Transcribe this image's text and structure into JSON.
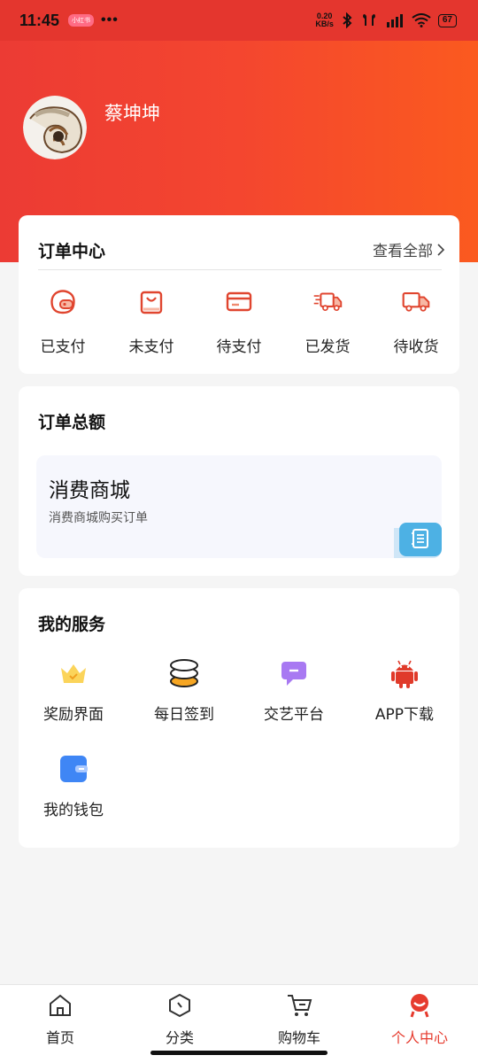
{
  "status_bar": {
    "time": "11:45",
    "badge": "小红书",
    "dots": "•••",
    "speed_value": "0.20",
    "speed_unit": "KB/s",
    "battery": "67"
  },
  "profile": {
    "username": "蔡坤坤"
  },
  "order_center": {
    "title": "订单中心",
    "view_all": "查看全部",
    "items": [
      {
        "label": "已支付",
        "icon": "wallet-icon"
      },
      {
        "label": "未支付",
        "icon": "shopping-bag-icon"
      },
      {
        "label": "待支付",
        "icon": "card-icon"
      },
      {
        "label": "已发货",
        "icon": "delivery-truck-fast-icon"
      },
      {
        "label": "待收货",
        "icon": "delivery-truck-icon"
      }
    ]
  },
  "order_total": {
    "title": "订单总额",
    "mall_title": "消费商城",
    "mall_subtitle": "消费商城购买订单"
  },
  "services": {
    "title": "我的服务",
    "items": [
      {
        "label": "奖励界面",
        "icon": "crown-icon"
      },
      {
        "label": "每日签到",
        "icon": "coins-stack-icon"
      },
      {
        "label": "交艺平台",
        "icon": "chat-bubble-icon"
      },
      {
        "label": "APP下载",
        "icon": "android-icon"
      },
      {
        "label": "我的钱包",
        "icon": "wallet-blue-icon"
      }
    ]
  },
  "tabbar": {
    "items": [
      {
        "label": "首页",
        "icon": "home-icon"
      },
      {
        "label": "分类",
        "icon": "category-icon"
      },
      {
        "label": "购物车",
        "icon": "cart-icon"
      },
      {
        "label": "个人中心",
        "icon": "profile-icon",
        "active": true
      }
    ]
  },
  "colors": {
    "accent": "#e63b2e",
    "hero_start": "#ec3b34",
    "hero_end": "#fb5a1f"
  }
}
